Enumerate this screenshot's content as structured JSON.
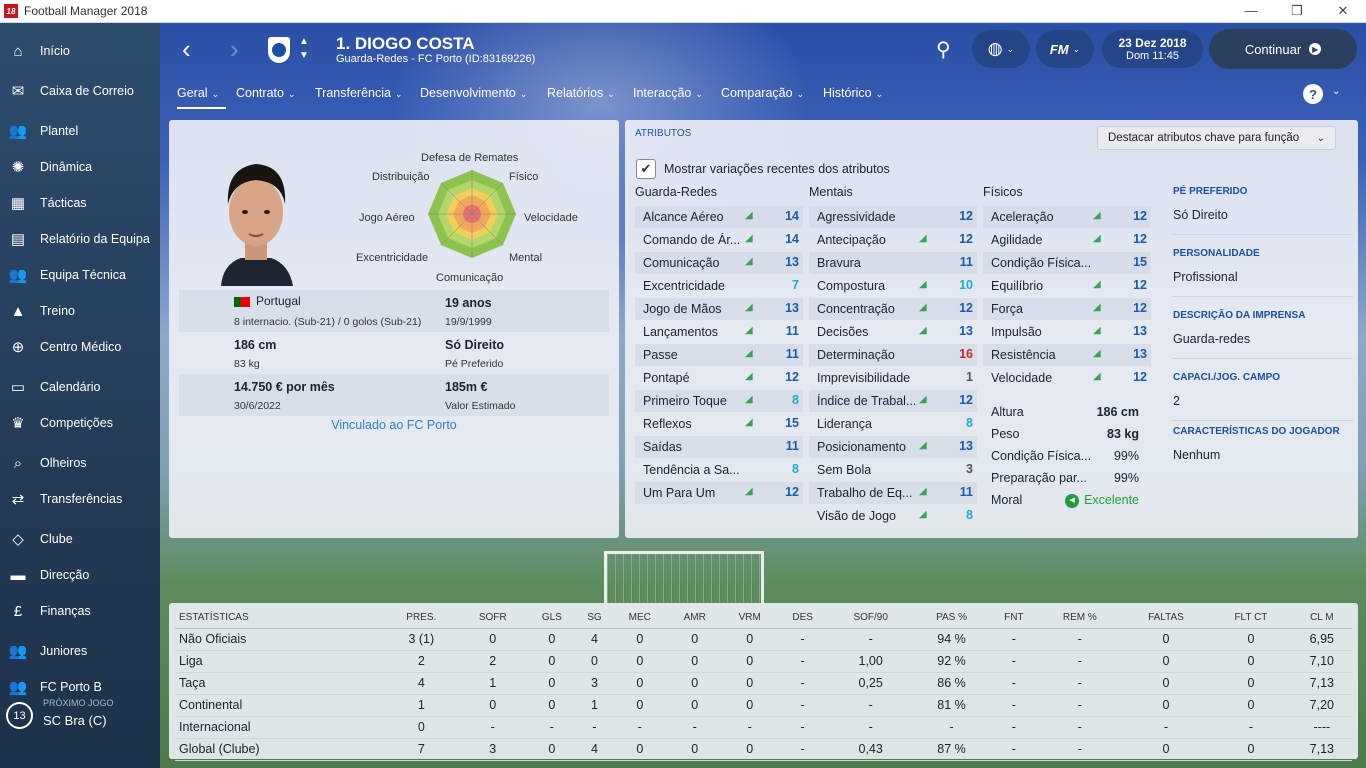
{
  "window": {
    "title": "Football Manager 2018",
    "logo": "18",
    "controls": [
      "—",
      "❐",
      "✕"
    ]
  },
  "sidebar": {
    "items": [
      {
        "label": "Início",
        "icon": "home-icon",
        "glyph": "⌂"
      },
      {
        "label": "Caixa de Correio",
        "icon": "inbox-icon",
        "glyph": "✉"
      },
      {
        "label": "Plantel",
        "icon": "squad-icon",
        "glyph": "👥"
      },
      {
        "label": "Dinâmica",
        "icon": "dynamics-icon",
        "glyph": "✺"
      },
      {
        "label": "Tácticas",
        "icon": "tactics-icon",
        "glyph": "▦"
      },
      {
        "label": "Relatório da Equipa",
        "icon": "report-icon",
        "glyph": "▤"
      },
      {
        "label": "Equipa Técnica",
        "icon": "staff-icon",
        "glyph": "👥"
      },
      {
        "label": "Treino",
        "icon": "training-icon",
        "glyph": "▲"
      },
      {
        "label": "Centro Médico",
        "icon": "medical-icon",
        "glyph": "⊕"
      },
      {
        "label": "Calendário",
        "icon": "calendar-icon",
        "glyph": "▭"
      },
      {
        "label": "Competições",
        "icon": "trophy-icon",
        "glyph": "♛"
      },
      {
        "label": "Olheiros",
        "icon": "scouting-icon",
        "glyph": "⌕"
      },
      {
        "label": "Transferências",
        "icon": "transfers-icon",
        "glyph": "⇄"
      },
      {
        "label": "Clube",
        "icon": "club-icon",
        "glyph": "◇"
      },
      {
        "label": "Direcção",
        "icon": "board-icon",
        "glyph": "▬"
      },
      {
        "label": "Finanças",
        "icon": "finances-icon",
        "glyph": "£"
      },
      {
        "label": "Juniores",
        "icon": "youth-icon",
        "glyph": "👥"
      },
      {
        "label": "FC Porto B",
        "icon": "reserve-team-icon",
        "glyph": "👥"
      }
    ],
    "next_game": {
      "label": "PRÓXIMO JOGO",
      "opponent": "SC Bra (C)",
      "days": "13"
    }
  },
  "header": {
    "player_name": "1. DIOGO COSTA",
    "player_sub": "Guarda-Redes - FC Porto (ID:83169226)",
    "date": "23 Dez 2018",
    "day_time": "Dom 11:45",
    "continue_label": "Continuar"
  },
  "tabs": [
    "Geral",
    "Contrato",
    "Transferência",
    "Desenvolvimento",
    "Relatórios",
    "Interacção",
    "Comparação",
    "Histórico"
  ],
  "profile": {
    "radar_labels": {
      "top": "Defesa de Remates",
      "top_left": "Distribuição",
      "top_right": "Físico",
      "left": "Jogo Aéreo",
      "right": "Velocidade",
      "bottom_left": "Excentricidade",
      "bottom_right": "Mental",
      "bottom": "Comunicação"
    },
    "nationality": "Portugal",
    "caps": "8 internacio. (Sub-21) / 0 golos (Sub-21)",
    "age": "19 anos",
    "dob": "19/9/1999",
    "height": "186 cm",
    "weight": "83 kg",
    "foot": "Só Direito",
    "foot_label": "Pé Preferido",
    "wage": "14.750 € por mês",
    "contract_end": "30/6/2022",
    "value": "185m €",
    "value_label": "Valor Estimado",
    "linked": "Vinculado ao FC Porto"
  },
  "attributes": {
    "panel_title": "ATRIBUTOS",
    "highlight_label": "Destacar atributos chave para função",
    "show_changes_label": "Mostrar variações recentes dos atributos",
    "show_changes_checked": "✔",
    "gk_header": "Guarda-Redes",
    "mental_header": "Mentais",
    "physical_header": "Físicos",
    "goalkeeping": [
      {
        "name": "Alcance Aéreo",
        "value": "14",
        "tone": "blue",
        "arrow": "◢"
      },
      {
        "name": "Comando de Ár...",
        "value": "14",
        "tone": "blue",
        "arrow": "◢"
      },
      {
        "name": "Comunicação",
        "value": "13",
        "tone": "blue",
        "arrow": "◢"
      },
      {
        "name": "Excentricidade",
        "value": "7",
        "tone": "teal",
        "arrow": ""
      },
      {
        "name": "Jogo de Mãos",
        "value": "13",
        "tone": "blue",
        "arrow": "◢"
      },
      {
        "name": "Lançamentos",
        "value": "11",
        "tone": "blue",
        "arrow": "◢"
      },
      {
        "name": "Passe",
        "value": "11",
        "tone": "blue",
        "arrow": "◢"
      },
      {
        "name": "Pontapé",
        "value": "12",
        "tone": "blue",
        "arrow": "◢"
      },
      {
        "name": "Primeiro Toque",
        "value": "8",
        "tone": "teal",
        "arrow": "◢"
      },
      {
        "name": "Reflexos",
        "value": "15",
        "tone": "blue",
        "arrow": "◢"
      },
      {
        "name": "Saídas",
        "value": "11",
        "tone": "blue",
        "arrow": ""
      },
      {
        "name": "Tendência a Sa...",
        "value": "8",
        "tone": "teal",
        "arrow": ""
      },
      {
        "name": "Um Para Um",
        "value": "12",
        "tone": "blue",
        "arrow": "◢"
      }
    ],
    "mental": [
      {
        "name": "Agressividade",
        "value": "12",
        "tone": "blue",
        "arrow": ""
      },
      {
        "name": "Antecipação",
        "value": "12",
        "tone": "blue",
        "arrow": "◢"
      },
      {
        "name": "Bravura",
        "value": "11",
        "tone": "blue",
        "arrow": ""
      },
      {
        "name": "Compostura",
        "value": "10",
        "tone": "teal",
        "arrow": "◢"
      },
      {
        "name": "Concentração",
        "value": "12",
        "tone": "blue",
        "arrow": "◢"
      },
      {
        "name": "Decisões",
        "value": "13",
        "tone": "blue",
        "arrow": "◢"
      },
      {
        "name": "Determinação",
        "value": "16",
        "tone": "red",
        "arrow": ""
      },
      {
        "name": "Imprevisibilidade",
        "value": "1",
        "tone": "grey",
        "arrow": ""
      },
      {
        "name": "Índice de Trabal...",
        "value": "12",
        "tone": "blue",
        "arrow": "◢"
      },
      {
        "name": "Liderança",
        "value": "8",
        "tone": "teal",
        "arrow": ""
      },
      {
        "name": "Posicionamento",
        "value": "13",
        "tone": "blue",
        "arrow": "◢"
      },
      {
        "name": "Sem Bola",
        "value": "3",
        "tone": "grey",
        "arrow": ""
      },
      {
        "name": "Trabalho de Eq...",
        "value": "11",
        "tone": "blue",
        "arrow": "◢"
      },
      {
        "name": "Visão de Jogo",
        "value": "8",
        "tone": "teal",
        "arrow": "◢"
      }
    ],
    "physical": [
      {
        "name": "Aceleração",
        "value": "12",
        "tone": "blue",
        "arrow": "◢"
      },
      {
        "name": "Agilidade",
        "value": "12",
        "tone": "blue",
        "arrow": "◢"
      },
      {
        "name": "Condição Física...",
        "value": "15",
        "tone": "blue",
        "arrow": ""
      },
      {
        "name": "Equilíbrio",
        "value": "12",
        "tone": "blue",
        "arrow": "◢"
      },
      {
        "name": "Força",
        "value": "12",
        "tone": "blue",
        "arrow": "◢"
      },
      {
        "name": "Impulsão",
        "value": "13",
        "tone": "blue",
        "arrow": "◢"
      },
      {
        "name": "Resistência",
        "value": "13",
        "tone": "blue",
        "arrow": "◢"
      },
      {
        "name": "Velocidade",
        "value": "12",
        "tone": "blue",
        "arrow": "◢"
      }
    ],
    "physical_info": [
      {
        "label": "Altura",
        "value": "186 cm"
      },
      {
        "label": "Peso",
        "value": "83 kg"
      },
      {
        "label": "Condição Física...",
        "value": "99%"
      },
      {
        "label": "Preparação par...",
        "value": "99%"
      },
      {
        "label": "Moral",
        "value": "Excelente"
      }
    ],
    "side_sections": [
      {
        "heading": "PÉ PREFERIDO",
        "value": "Só Direito"
      },
      {
        "heading": "PERSONALIDADE",
        "value": "Profissional"
      },
      {
        "heading": "DESCRIÇÃO DA IMPRENSA",
        "value": "Guarda-redes"
      },
      {
        "heading": "CAPACI./JOG. CAMPO",
        "value": "2"
      },
      {
        "heading": "CARACTERÍSTICAS DO JOGADOR",
        "value": "Nenhum"
      }
    ]
  },
  "stats": {
    "headers": [
      "ESTATÍSTICAS",
      "PRES.",
      "SOFR",
      "GLS",
      "SG",
      "MEC",
      "AMR",
      "VRM",
      "DES",
      "SOF/90",
      "PAS %",
      "FNT",
      "REM %",
      "FALTAS",
      "FLT CT",
      "CL M"
    ],
    "rows": [
      [
        "Não Oficiais",
        "3 (1)",
        "0",
        "0",
        "4",
        "0",
        "0",
        "0",
        "-",
        "-",
        "94 %",
        "-",
        "-",
        "0",
        "0",
        "6,95"
      ],
      [
        "Liga",
        "2",
        "2",
        "0",
        "0",
        "0",
        "0",
        "0",
        "-",
        "1,00",
        "92 %",
        "-",
        "-",
        "0",
        "0",
        "7,10"
      ],
      [
        "Taça",
        "4",
        "1",
        "0",
        "3",
        "0",
        "0",
        "0",
        "-",
        "0,25",
        "86 %",
        "-",
        "-",
        "0",
        "0",
        "7,13"
      ],
      [
        "Continental",
        "1",
        "0",
        "0",
        "1",
        "0",
        "0",
        "0",
        "-",
        "-",
        "81 %",
        "-",
        "-",
        "0",
        "0",
        "7,20"
      ],
      [
        "Internacional",
        "0",
        "-",
        "-",
        "-",
        "-",
        "-",
        "-",
        "-",
        "-",
        "-",
        "-",
        "-",
        "-",
        "-",
        "----"
      ],
      [
        "Global (Clube)",
        "7",
        "3",
        "0",
        "4",
        "0",
        "0",
        "0",
        "-",
        "0,43",
        "87 %",
        "-",
        "-",
        "0",
        "0",
        "7,13"
      ]
    ]
  },
  "colors": {
    "blue": "#1e5aa8",
    "teal": "#22aacc",
    "red": "#d0252b",
    "grey": "#555555",
    "arrow": "#3aa05a",
    "link": "#2f7fc7"
  }
}
